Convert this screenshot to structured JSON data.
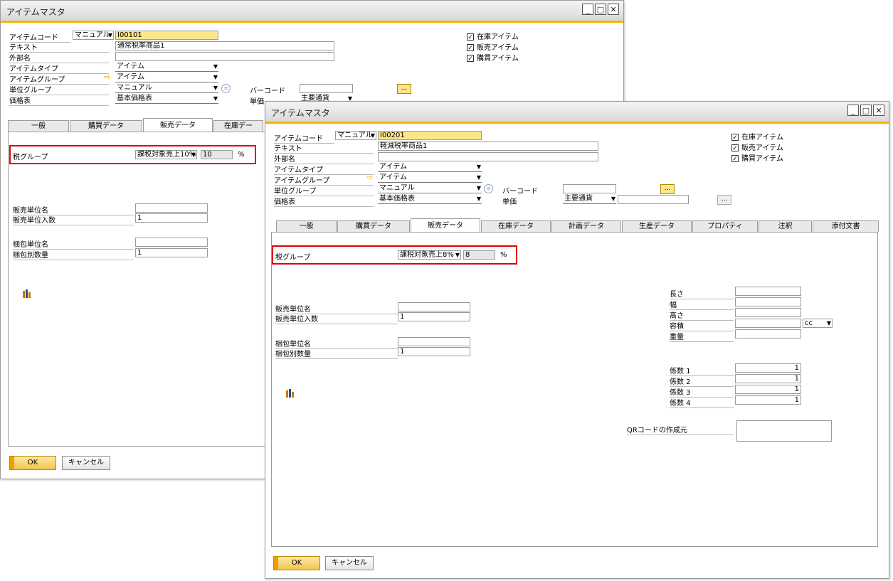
{
  "window1": {
    "title": "アイテムマスタ",
    "labels": {
      "item_code": "アイテムコード",
      "text": "テキスト",
      "foreign_name": "外部名",
      "item_type": "アイテムタイプ",
      "item_group": "アイテムグループ",
      "uom_group": "単位グループ",
      "price_list": "価格表",
      "barcode": "バーコード",
      "unit_price": "単価"
    },
    "values": {
      "series": "マニュアル",
      "item_code": "I00101",
      "text": "通常税率商品1",
      "item_type": "アイテム",
      "item_group": "アイテム",
      "uom_group": "マニュアル",
      "price_list": "基本価格表",
      "currency": "主要通貨"
    },
    "checkboxes": [
      {
        "label": "在庫アイテム",
        "checked": true
      },
      {
        "label": "販売アイテム",
        "checked": true
      },
      {
        "label": "購買アイテム",
        "checked": true
      }
    ],
    "tabs": [
      "一般",
      "購買データ",
      "販売データ",
      "在庫デー"
    ],
    "sales": {
      "tax_group_label": "税グループ",
      "tax_group_value": "課税対象売上10%",
      "tax_rate": "10",
      "percent": "%",
      "sales_unit_label": "販売単位名",
      "items_per_unit_label": "販売単位入数",
      "items_per_unit": "1",
      "packaging_label": "梱包単位名",
      "qty_per_package_label": "梱包別数量",
      "qty_per_package": "1"
    },
    "buttons": {
      "ok": "OK",
      "cancel": "キャンセル"
    }
  },
  "window2": {
    "title": "アイテムマスタ",
    "labels": {
      "item_code": "アイテムコード",
      "text": "テキスト",
      "foreign_name": "外部名",
      "item_type": "アイテムタイプ",
      "item_group": "アイテムグループ",
      "uom_group": "単位グループ",
      "price_list": "価格表",
      "barcode": "バーコード",
      "unit_price": "単価"
    },
    "values": {
      "series": "マニュアル",
      "item_code": "I00201",
      "text": "軽減税率商品1",
      "item_type": "アイテム",
      "item_group": "アイテム",
      "uom_group": "マニュアル",
      "price_list": "基本価格表",
      "currency": "主要通貨"
    },
    "checkboxes": [
      {
        "label": "在庫アイテム",
        "checked": true
      },
      {
        "label": "販売アイテム",
        "checked": true
      },
      {
        "label": "購買アイテム",
        "checked": true
      }
    ],
    "tabs": [
      "一般",
      "購買データ",
      "販売データ",
      "在庫データ",
      "計画データ",
      "生産データ",
      "プロパティ",
      "注釈",
      "添付文書"
    ],
    "sales": {
      "tax_group_label": "税グループ",
      "tax_group_value": "課税対象売上8%",
      "tax_rate": "8",
      "percent": "%",
      "sales_unit_label": "販売単位名",
      "items_per_unit_label": "販売単位入数",
      "items_per_unit": "1",
      "packaging_label": "梱包単位名",
      "qty_per_package_label": "梱包別数量",
      "qty_per_package": "1"
    },
    "dimensions": {
      "length": "長さ",
      "width": "幅",
      "height": "高さ",
      "volume": "容積",
      "weight": "重量",
      "volume_unit": "cc"
    },
    "factors": [
      {
        "label": "係数 1",
        "value": "1"
      },
      {
        "label": "係数 2",
        "value": "1"
      },
      {
        "label": "係数 3",
        "value": "1"
      },
      {
        "label": "係数 4",
        "value": "1"
      }
    ],
    "qr_label": "QRコードの作成元",
    "buttons": {
      "ok": "OK",
      "cancel": "キャンセル"
    }
  },
  "colors": {
    "accent": "#f2b400",
    "highlight_border": "#e00000",
    "field_yellow": "#fde58c"
  }
}
